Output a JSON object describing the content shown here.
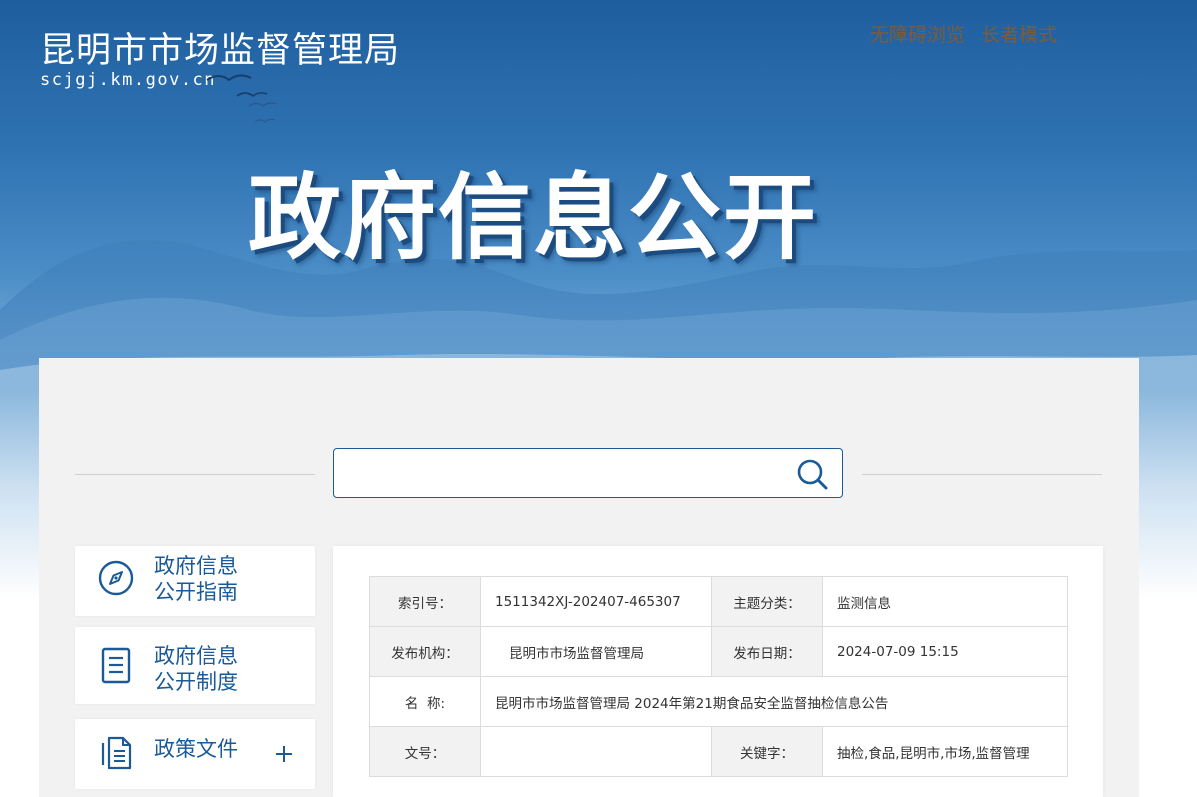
{
  "header": {
    "site_title": "昆明市市场监督管理局",
    "site_domain": "scjgj.km.gov.cn",
    "accessibility_label": "无障碍浏览",
    "elderly_mode_label": "长者模式",
    "banner_title": "政府信息公开"
  },
  "search": {
    "value": "",
    "placeholder": ""
  },
  "sidebar": {
    "items": [
      {
        "line1": "政府信息",
        "line2": "公开指南",
        "icon": "compass-icon"
      },
      {
        "line1": "政府信息",
        "line2": "公开制度",
        "icon": "document-icon"
      },
      {
        "line1": "政策文件",
        "line2": "",
        "icon": "files-icon",
        "expand": "+"
      }
    ]
  },
  "info_table": {
    "rows": [
      {
        "label1": "索引号：",
        "value1": "1511342XJ-202407-465307",
        "label2": "主题分类：",
        "value2": "监测信息"
      },
      {
        "label1": "发布机构：",
        "value1": "昆明市市场监督管理局",
        "label2": "发布日期：",
        "value2": "2024-07-09 15:15"
      },
      {
        "label1": "名  称:",
        "value1": "昆明市市场监督管理局 2024年第21期食品安全监督抽检信息公告"
      },
      {
        "label1": "文号：",
        "value1": "",
        "label2": "关键字：",
        "value2": "抽检,食品,昆明市,市场,监督管理"
      }
    ]
  },
  "colors": {
    "brand_blue": "#1a5a98",
    "top_link_brown": "#7d5c39",
    "panel_bg": "#f2f2f2"
  }
}
